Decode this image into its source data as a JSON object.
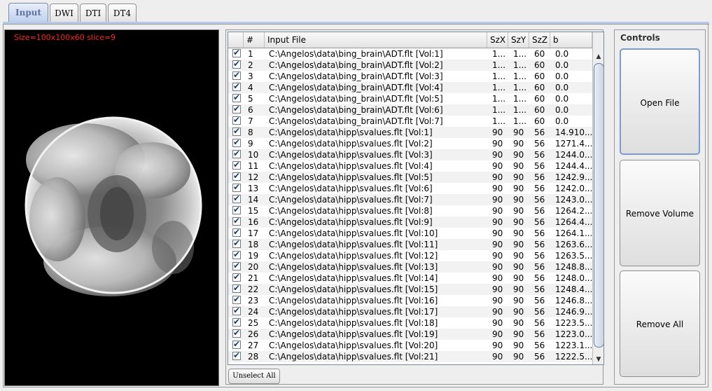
{
  "tabs": [
    {
      "label": "Input",
      "active": true
    },
    {
      "label": "DWI",
      "active": false
    },
    {
      "label": "DTI",
      "active": false
    },
    {
      "label": "DT4",
      "active": false
    }
  ],
  "viewer": {
    "info": "Size=100x100x60 slice=9",
    "background_color": "#000000",
    "info_color": "#ff2020"
  },
  "table": {
    "columns": [
      "#",
      "Input File",
      "SzX",
      "SzY",
      "SzZ",
      "b"
    ],
    "rows": [
      {
        "checked": true,
        "n": "1",
        "file": "C:\\Angelos\\data\\bing_brain\\ADT.flt [Vol:1]",
        "szx": "1...",
        "szy": "1...",
        "szz": "60",
        "b": "0.0"
      },
      {
        "checked": true,
        "n": "2",
        "file": "C:\\Angelos\\data\\bing_brain\\ADT.flt [Vol:2]",
        "szx": "1...",
        "szy": "1...",
        "szz": "60",
        "b": "0.0"
      },
      {
        "checked": true,
        "n": "3",
        "file": "C:\\Angelos\\data\\bing_brain\\ADT.flt [Vol:3]",
        "szx": "1...",
        "szy": "1...",
        "szz": "60",
        "b": "0.0"
      },
      {
        "checked": true,
        "n": "4",
        "file": "C:\\Angelos\\data\\bing_brain\\ADT.flt [Vol:4]",
        "szx": "1...",
        "szy": "1...",
        "szz": "60",
        "b": "0.0"
      },
      {
        "checked": true,
        "n": "5",
        "file": "C:\\Angelos\\data\\bing_brain\\ADT.flt [Vol:5]",
        "szx": "1...",
        "szy": "1...",
        "szz": "60",
        "b": "0.0"
      },
      {
        "checked": true,
        "n": "6",
        "file": "C:\\Angelos\\data\\bing_brain\\ADT.flt [Vol:6]",
        "szx": "1...",
        "szy": "1...",
        "szz": "60",
        "b": "0.0"
      },
      {
        "checked": true,
        "n": "7",
        "file": "C:\\Angelos\\data\\bing_brain\\ADT.flt [Vol:7]",
        "szx": "1...",
        "szy": "1...",
        "szz": "60",
        "b": "0.0"
      },
      {
        "checked": true,
        "n": "8",
        "file": "C:\\Angelos\\data\\hipp\\svalues.flt [Vol:1]",
        "szx": "90",
        "szy": "90",
        "szz": "56",
        "b": "14.910..."
      },
      {
        "checked": true,
        "n": "9",
        "file": "C:\\Angelos\\data\\hipp\\svalues.flt [Vol:2]",
        "szx": "90",
        "szy": "90",
        "szz": "56",
        "b": "1271.4..."
      },
      {
        "checked": true,
        "n": "10",
        "file": "C:\\Angelos\\data\\hipp\\svalues.flt [Vol:3]",
        "szx": "90",
        "szy": "90",
        "szz": "56",
        "b": "1244.0..."
      },
      {
        "checked": true,
        "n": "11",
        "file": "C:\\Angelos\\data\\hipp\\svalues.flt [Vol:4]",
        "szx": "90",
        "szy": "90",
        "szz": "56",
        "b": "1244.4..."
      },
      {
        "checked": true,
        "n": "12",
        "file": "C:\\Angelos\\data\\hipp\\svalues.flt [Vol:5]",
        "szx": "90",
        "szy": "90",
        "szz": "56",
        "b": "1242.9..."
      },
      {
        "checked": true,
        "n": "13",
        "file": "C:\\Angelos\\data\\hipp\\svalues.flt [Vol:6]",
        "szx": "90",
        "szy": "90",
        "szz": "56",
        "b": "1242.0..."
      },
      {
        "checked": true,
        "n": "14",
        "file": "C:\\Angelos\\data\\hipp\\svalues.flt [Vol:7]",
        "szx": "90",
        "szy": "90",
        "szz": "56",
        "b": "1243.0..."
      },
      {
        "checked": true,
        "n": "15",
        "file": "C:\\Angelos\\data\\hipp\\svalues.flt [Vol:8]",
        "szx": "90",
        "szy": "90",
        "szz": "56",
        "b": "1264.2..."
      },
      {
        "checked": true,
        "n": "16",
        "file": "C:\\Angelos\\data\\hipp\\svalues.flt [Vol:9]",
        "szx": "90",
        "szy": "90",
        "szz": "56",
        "b": "1264.4..."
      },
      {
        "checked": true,
        "n": "17",
        "file": "C:\\Angelos\\data\\hipp\\svalues.flt [Vol:10]",
        "szx": "90",
        "szy": "90",
        "szz": "56",
        "b": "1264.1..."
      },
      {
        "checked": true,
        "n": "18",
        "file": "C:\\Angelos\\data\\hipp\\svalues.flt [Vol:11]",
        "szx": "90",
        "szy": "90",
        "szz": "56",
        "b": "1263.6..."
      },
      {
        "checked": true,
        "n": "19",
        "file": "C:\\Angelos\\data\\hipp\\svalues.flt [Vol:12]",
        "szx": "90",
        "szy": "90",
        "szz": "56",
        "b": "1263.5..."
      },
      {
        "checked": true,
        "n": "20",
        "file": "C:\\Angelos\\data\\hipp\\svalues.flt [Vol:13]",
        "szx": "90",
        "szy": "90",
        "szz": "56",
        "b": "1248.8..."
      },
      {
        "checked": true,
        "n": "21",
        "file": "C:\\Angelos\\data\\hipp\\svalues.flt [Vol:14]",
        "szx": "90",
        "szy": "90",
        "szz": "56",
        "b": "1248.0..."
      },
      {
        "checked": true,
        "n": "22",
        "file": "C:\\Angelos\\data\\hipp\\svalues.flt [Vol:15]",
        "szx": "90",
        "szy": "90",
        "szz": "56",
        "b": "1248.4..."
      },
      {
        "checked": true,
        "n": "23",
        "file": "C:\\Angelos\\data\\hipp\\svalues.flt [Vol:16]",
        "szx": "90",
        "szy": "90",
        "szz": "56",
        "b": "1246.8..."
      },
      {
        "checked": true,
        "n": "24",
        "file": "C:\\Angelos\\data\\hipp\\svalues.flt [Vol:17]",
        "szx": "90",
        "szy": "90",
        "szz": "56",
        "b": "1246.9..."
      },
      {
        "checked": true,
        "n": "25",
        "file": "C:\\Angelos\\data\\hipp\\svalues.flt [Vol:18]",
        "szx": "90",
        "szy": "90",
        "szz": "56",
        "b": "1223.5..."
      },
      {
        "checked": true,
        "n": "26",
        "file": "C:\\Angelos\\data\\hipp\\svalues.flt [Vol:19]",
        "szx": "90",
        "szy": "90",
        "szz": "56",
        "b": "1223.0..."
      },
      {
        "checked": true,
        "n": "27",
        "file": "C:\\Angelos\\data\\hipp\\svalues.flt [Vol:20]",
        "szx": "90",
        "szy": "90",
        "szz": "56",
        "b": "1223.1..."
      },
      {
        "checked": true,
        "n": "28",
        "file": "C:\\Angelos\\data\\hipp\\svalues.flt [Vol:21]",
        "szx": "90",
        "szy": "90",
        "szz": "56",
        "b": "1222.5..."
      }
    ],
    "unselect_label": "Unselect All"
  },
  "controls": {
    "title": "Controls",
    "buttons": [
      "Open File",
      "Remove Volume",
      "Remove All"
    ]
  },
  "colors": {
    "accent": "#7b9ccf",
    "active_tab_text": "#5d6fa3",
    "checkmark": "#1d3a78"
  }
}
